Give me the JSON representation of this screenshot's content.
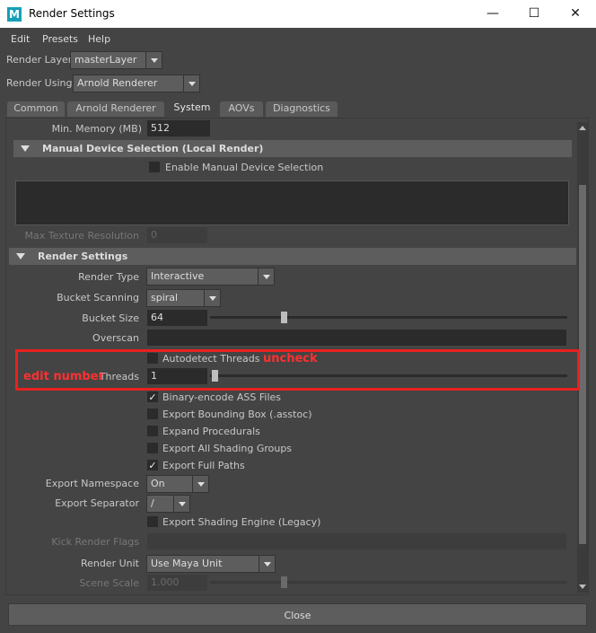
{
  "window": {
    "title": "Render Settings",
    "app_icon": "M",
    "minimize": "—",
    "maximize": "☐",
    "close": "✕"
  },
  "menu": [
    "Edit",
    "Presets",
    "Help"
  ],
  "render_layer": {
    "label": "Render Layer",
    "value": "masterLayer"
  },
  "render_using": {
    "label": "Render Using",
    "value": "Arnold Renderer"
  },
  "tabs": [
    "Common",
    "Arnold Renderer",
    "System",
    "AOVs",
    "Diagnostics"
  ],
  "active_tab": "System",
  "system": {
    "min_memory": {
      "label": "Min. Memory (MB)",
      "value": "512"
    },
    "manual_device_section": "Manual Device Selection (Local Render)",
    "enable_manual_device": {
      "label": "Enable Manual Device Selection",
      "checked": false
    },
    "max_texture_resolution": {
      "label": "Max Texture Resolution",
      "value": "0"
    },
    "render_settings_section": "Render Settings",
    "render_type": {
      "label": "Render Type",
      "value": "Interactive"
    },
    "bucket_scanning": {
      "label": "Bucket Scanning",
      "value": "spiral"
    },
    "bucket_size": {
      "label": "Bucket Size",
      "value": "64"
    },
    "overscan": {
      "label": "Overscan",
      "value": ""
    },
    "autodetect_threads": {
      "label": "Autodetect Threads",
      "checked": false
    },
    "threads": {
      "label": "Threads",
      "value": "1"
    },
    "checkboxes": [
      {
        "label": "Binary-encode ASS Files",
        "checked": true
      },
      {
        "label": "Export Bounding Box (.asstoc)",
        "checked": false
      },
      {
        "label": "Expand Procedurals",
        "checked": false
      },
      {
        "label": "Export All Shading Groups",
        "checked": false
      },
      {
        "label": "Export Full Paths",
        "checked": true
      }
    ],
    "export_namespace": {
      "label": "Export Namespace",
      "value": "On"
    },
    "export_separator": {
      "label": "Export Separator",
      "value": "/"
    },
    "export_shading_engine": {
      "label": "Export Shading Engine (Legacy)",
      "checked": false
    },
    "kick_render_flags": {
      "label": "Kick Render Flags",
      "value": ""
    },
    "render_unit": {
      "label": "Render Unit",
      "value": "Use Maya Unit"
    },
    "scene_scale": {
      "label": "Scene Scale",
      "value": "1.000"
    }
  },
  "annotations": {
    "uncheck": "uncheck",
    "edit_number": "edit number",
    "color": "#e82020"
  },
  "close_button": "Close"
}
